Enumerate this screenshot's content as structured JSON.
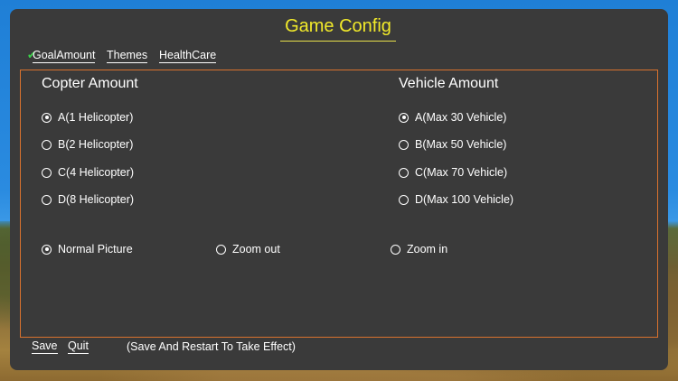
{
  "title": "Game Config",
  "tabs": [
    {
      "label": "GoalAmount",
      "checked": true
    },
    {
      "label": "Themes",
      "checked": false
    },
    {
      "label": "HealthCare",
      "checked": false
    }
  ],
  "copter": {
    "title": "Copter Amount",
    "options": [
      {
        "label": "A(1 Helicopter)",
        "selected": true
      },
      {
        "label": "B(2 Helicopter)",
        "selected": false
      },
      {
        "label": "C(4 Helicopter)",
        "selected": false
      },
      {
        "label": "D(8 Helicopter)",
        "selected": false
      }
    ]
  },
  "vehicle": {
    "title": "Vehicle Amount",
    "options": [
      {
        "label": "A(Max 30 Vehicle)",
        "selected": true
      },
      {
        "label": "B(Max 50 Vehicle)",
        "selected": false
      },
      {
        "label": "C(Max 70 Vehicle)",
        "selected": false
      },
      {
        "label": "D(Max 100 Vehicle)",
        "selected": false
      }
    ]
  },
  "picture": {
    "options": [
      {
        "label": "Normal Picture",
        "selected": true
      },
      {
        "label": "Zoom out",
        "selected": false
      },
      {
        "label": "Zoom in",
        "selected": false
      }
    ]
  },
  "footer": {
    "save_label": "Save",
    "quit_label": "Quit",
    "note": "(Save And Restart To Take Effect)"
  },
  "colors": {
    "panel": "#3a3a3a",
    "title": "#f2ea2a",
    "frame_border": "#d9722e",
    "check": "#3bd14a",
    "sky": "#2a8be0"
  },
  "icons": {
    "tab_check": "checkmark-icon",
    "radio": "radio-button-icon"
  }
}
